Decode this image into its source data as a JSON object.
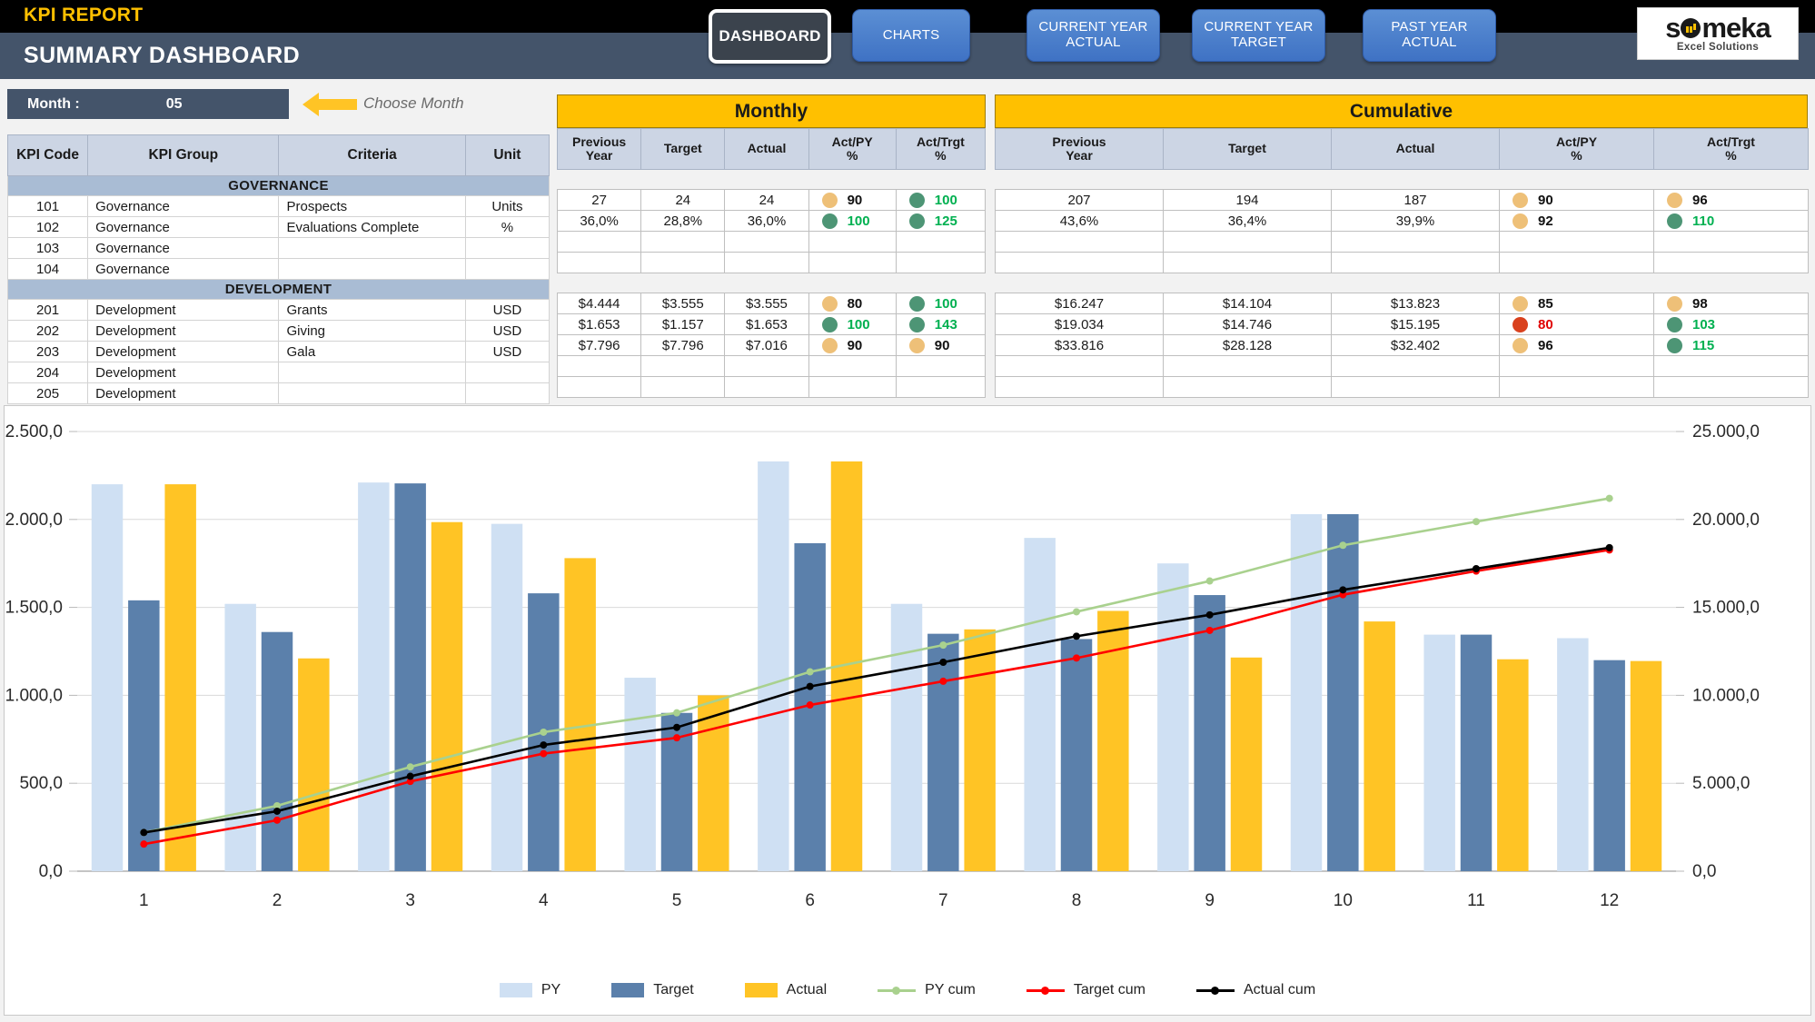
{
  "header": {
    "kpi_report_title": "KPI REPORT",
    "dashboard_title": "SUMMARY DASHBOARD",
    "accent_yellow": "#ffc000",
    "header_blue": "#44546a",
    "nav": [
      {
        "label": "DASHBOARD",
        "active": true
      },
      {
        "label": "CHARTS",
        "active": false
      },
      {
        "label": "CURRENT YEAR ACTUAL",
        "line1": "CURRENT YEAR",
        "line2": "ACTUAL",
        "active": false
      },
      {
        "label": "CURRENT YEAR TARGET",
        "line1": "CURRENT YEAR",
        "line2": "TARGET",
        "active": false
      },
      {
        "label": "PAST YEAR ACTUAL",
        "line1": "PAST YEAR",
        "line2": "ACTUAL",
        "active": false
      }
    ],
    "logo": {
      "name": "someka",
      "tagline": "Excel Solutions"
    }
  },
  "month_selector": {
    "label": "Month :",
    "value": "05",
    "hint": "Choose Month"
  },
  "kpi_table": {
    "columns": [
      "KPI Code",
      "KPI Group",
      "Criteria",
      "Unit"
    ],
    "groups": [
      {
        "name": "GOVERNANCE",
        "rows": [
          {
            "code": "101",
            "group": "Governance",
            "criteria": "Prospects",
            "unit": "Units"
          },
          {
            "code": "102",
            "group": "Governance",
            "criteria": "Evaluations Complete",
            "unit": "%"
          },
          {
            "code": "103",
            "group": "Governance",
            "criteria": "",
            "unit": ""
          },
          {
            "code": "104",
            "group": "Governance",
            "criteria": "",
            "unit": ""
          }
        ]
      },
      {
        "name": "DEVELOPMENT",
        "rows": [
          {
            "code": "201",
            "group": "Development",
            "criteria": "Grants",
            "unit": "USD"
          },
          {
            "code": "202",
            "group": "Development",
            "criteria": "Giving",
            "unit": "USD"
          },
          {
            "code": "203",
            "group": "Development",
            "criteria": "Gala",
            "unit": "USD"
          },
          {
            "code": "204",
            "group": "Development",
            "criteria": "",
            "unit": ""
          },
          {
            "code": "205",
            "group": "Development",
            "criteria": "",
            "unit": ""
          }
        ]
      }
    ]
  },
  "monthly": {
    "title": "Monthly",
    "columns": [
      "Previous Year",
      "Target",
      "Actual",
      "Act/PY %",
      "Act/Trgt %"
    ],
    "column_lines": [
      {
        "l1": "Previous",
        "l2": "Year"
      },
      {
        "l1": "Target",
        "l2": ""
      },
      {
        "l1": "Actual",
        "l2": ""
      },
      {
        "l1": "Act/PY",
        "l2": "%"
      },
      {
        "l1": "Act/Trgt",
        "l2": "%"
      }
    ],
    "groups": [
      {
        "rows": [
          {
            "py": "27",
            "target": "24",
            "actual": "24",
            "act_py": "90",
            "act_py_status": "amber",
            "act_trgt": "100",
            "act_trgt_status": "green"
          },
          {
            "py": "36,0%",
            "target": "28,8%",
            "actual": "36,0%",
            "act_py": "100",
            "act_py_status": "green",
            "act_trgt": "125",
            "act_trgt_status": "green"
          },
          {
            "py": "",
            "target": "",
            "actual": "",
            "act_py": "",
            "act_py_status": "",
            "act_trgt": "",
            "act_trgt_status": ""
          },
          {
            "py": "",
            "target": "",
            "actual": "",
            "act_py": "",
            "act_py_status": "",
            "act_trgt": "",
            "act_trgt_status": ""
          }
        ]
      },
      {
        "rows": [
          {
            "py": "$4.444",
            "target": "$3.555",
            "actual": "$3.555",
            "act_py": "80",
            "act_py_status": "amber",
            "act_trgt": "100",
            "act_trgt_status": "green"
          },
          {
            "py": "$1.653",
            "target": "$1.157",
            "actual": "$1.653",
            "act_py": "100",
            "act_py_status": "green",
            "act_trgt": "143",
            "act_trgt_status": "green"
          },
          {
            "py": "$7.796",
            "target": "$7.796",
            "actual": "$7.016",
            "act_py": "90",
            "act_py_status": "amber",
            "act_trgt": "90",
            "act_trgt_status": "amber"
          },
          {
            "py": "",
            "target": "",
            "actual": "",
            "act_py": "",
            "act_py_status": "",
            "act_trgt": "",
            "act_trgt_status": ""
          },
          {
            "py": "",
            "target": "",
            "actual": "",
            "act_py": "",
            "act_py_status": "",
            "act_trgt": "",
            "act_trgt_status": ""
          }
        ]
      }
    ]
  },
  "cumulative": {
    "title": "Cumulative",
    "columns": [
      "Previous Year",
      "Target",
      "Actual",
      "Act/PY %",
      "Act/Trgt %"
    ],
    "column_lines": [
      {
        "l1": "Previous",
        "l2": "Year"
      },
      {
        "l1": "Target",
        "l2": ""
      },
      {
        "l1": "Actual",
        "l2": ""
      },
      {
        "l1": "Act/PY",
        "l2": "%"
      },
      {
        "l1": "Act/Trgt",
        "l2": "%"
      }
    ],
    "groups": [
      {
        "rows": [
          {
            "py": "207",
            "target": "194",
            "actual": "187",
            "act_py": "90",
            "act_py_status": "amber",
            "act_trgt": "96",
            "act_trgt_status": "amber"
          },
          {
            "py": "43,6%",
            "target": "36,4%",
            "actual": "39,9%",
            "act_py": "92",
            "act_py_status": "amber",
            "act_trgt": "110",
            "act_trgt_status": "green"
          },
          {
            "py": "",
            "target": "",
            "actual": "",
            "act_py": "",
            "act_py_status": "",
            "act_trgt": "",
            "act_trgt_status": ""
          },
          {
            "py": "",
            "target": "",
            "actual": "",
            "act_py": "",
            "act_py_status": "",
            "act_trgt": "",
            "act_trgt_status": ""
          }
        ]
      },
      {
        "rows": [
          {
            "py": "$16.247",
            "target": "$14.104",
            "actual": "$13.823",
            "act_py": "85",
            "act_py_status": "amber",
            "act_trgt": "98",
            "act_trgt_status": "amber"
          },
          {
            "py": "$19.034",
            "target": "$14.746",
            "actual": "$15.195",
            "act_py": "80",
            "act_py_status": "red",
            "act_trgt": "103",
            "act_trgt_status": "green"
          },
          {
            "py": "$33.816",
            "target": "$28.128",
            "actual": "$32.402",
            "act_py": "96",
            "act_py_status": "amber",
            "act_trgt": "115",
            "act_trgt_status": "green"
          },
          {
            "py": "",
            "target": "",
            "actual": "",
            "act_py": "",
            "act_py_status": "",
            "act_trgt": "",
            "act_trgt_status": ""
          },
          {
            "py": "",
            "target": "",
            "actual": "",
            "act_py": "",
            "act_py_status": "",
            "act_trgt": "",
            "act_trgt_status": ""
          }
        ]
      }
    ]
  },
  "chart_data": {
    "type": "bar",
    "title": "",
    "xlabel": "",
    "ylabel": "",
    "categories": [
      "1",
      "2",
      "3",
      "4",
      "5",
      "6",
      "7",
      "8",
      "9",
      "10",
      "11",
      "12"
    ],
    "y_left_ticks": [
      "0,0",
      "500,0",
      "1.000,0",
      "1.500,0",
      "2.000,0",
      "2.500,0"
    ],
    "y_right_ticks": [
      "0,0",
      "5.000,0",
      "10.000,0",
      "15.000,0",
      "20.000,0",
      "25.000,0"
    ],
    "ylim_left": [
      0,
      2500
    ],
    "ylim_right": [
      0,
      25000
    ],
    "grid": true,
    "legend_position": "bottom",
    "colors": {
      "py": "#cfe0f3",
      "target": "#5b80ab",
      "actual": "#ffc425",
      "py_cum": "#a9d18e",
      "target_cum": "#ff0000",
      "actual_cum": "#000000"
    },
    "series": [
      {
        "name": "PY",
        "type": "bar",
        "axis": "left",
        "values": [
          2200,
          1520,
          2210,
          1975,
          1100,
          2330,
          1520,
          1895,
          1750,
          2030,
          1345,
          1325
        ]
      },
      {
        "name": "Target",
        "type": "bar",
        "axis": "left",
        "values": [
          1540,
          1360,
          2205,
          1580,
          900,
          1865,
          1350,
          1320,
          1570,
          2030,
          1345,
          1200
        ]
      },
      {
        "name": "Actual",
        "type": "bar",
        "axis": "left",
        "values": [
          2200,
          1210,
          1985,
          1780,
          1000,
          2330,
          1375,
          1480,
          1215,
          1420,
          1205,
          1195
        ]
      },
      {
        "name": "PY cum",
        "type": "line",
        "axis": "right",
        "values": [
          2200,
          3720,
          5930,
          7905,
          9005,
          11335,
          12855,
          14750,
          16500,
          18530,
          19875,
          21200
        ]
      },
      {
        "name": "Target cum",
        "type": "line",
        "axis": "right",
        "values": [
          1540,
          2900,
          5105,
          6685,
          7585,
          9450,
          10800,
          12120,
          13690,
          15720,
          17065,
          18265
        ]
      },
      {
        "name": "Actual cum",
        "type": "line",
        "axis": "right",
        "values": [
          2200,
          3410,
          5395,
          7175,
          8175,
          10505,
          11880,
          13360,
          14575,
          15995,
          17200,
          18395
        ]
      }
    ],
    "legend": [
      "PY",
      "Target",
      "Actual",
      "PY cum",
      "Target cum",
      "Actual cum"
    ]
  }
}
